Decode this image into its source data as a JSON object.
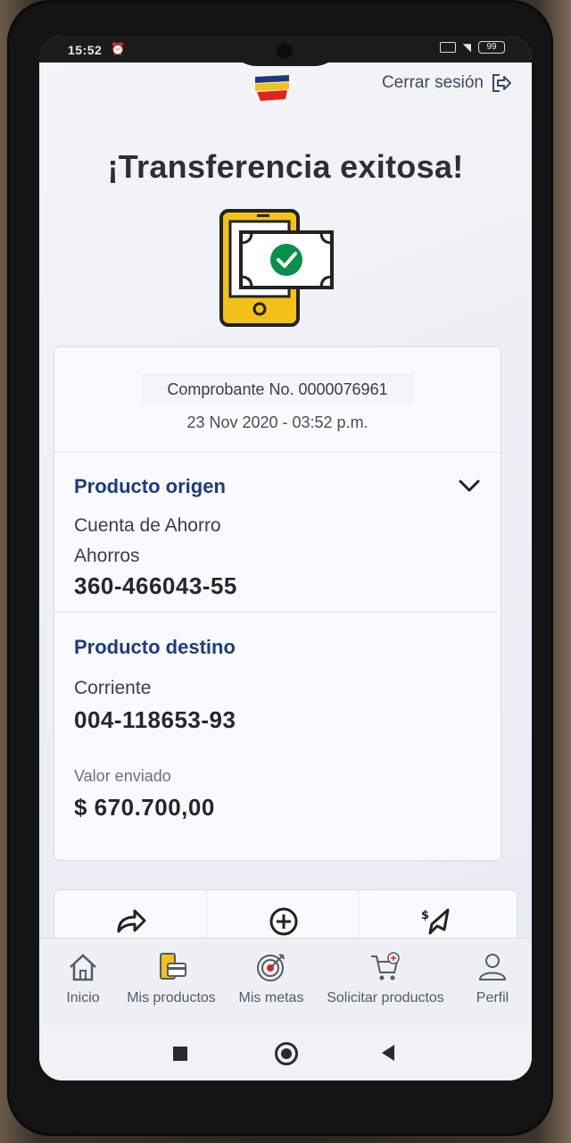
{
  "status_bar": {
    "time": "15:52",
    "notification_icon": "alarm-icon",
    "battery": "99"
  },
  "header": {
    "logo_icon": "bank-flag-logo",
    "logout_label": "Cerrar sesión",
    "logout_icon": "logout-arrow-icon"
  },
  "title": "¡Transferencia exitosa!",
  "hero_icon": "phone-money-check-icon",
  "receipt": {
    "number": "Comprobante No. 0000076961",
    "date": "23 Nov 2020 - 03:52 p.m."
  },
  "origin": {
    "title": "Producto origen",
    "type": "Cuenta de Ahorro",
    "subtype": "Ahorros",
    "account": "360-466043-55"
  },
  "destination": {
    "title": "Producto destino",
    "type": "Corriente",
    "account": "004-118653-93"
  },
  "amount": {
    "label": "Valor enviado",
    "value": "$ 670.700,00"
  },
  "actions": [
    {
      "icon": "share-arrow-icon"
    },
    {
      "icon": "add-circle-icon"
    },
    {
      "icon": "send-money-icon"
    }
  ],
  "bottom_nav": {
    "items": [
      {
        "label": "Inicio",
        "icon": "home-icon"
      },
      {
        "label": "Mis productos",
        "icon": "products-icon"
      },
      {
        "label": "Mis metas",
        "icon": "target-icon"
      },
      {
        "label": "Solicitar productos",
        "icon": "cart-add-icon"
      },
      {
        "label": "Perfil",
        "icon": "user-icon"
      }
    ]
  },
  "colors": {
    "accent": "#1f3a7c",
    "brand_yellow": "#f2c21b",
    "brand_red": "#e2241b",
    "brand_blue": "#1f3a7c",
    "success_green": "#0a8f4a"
  }
}
